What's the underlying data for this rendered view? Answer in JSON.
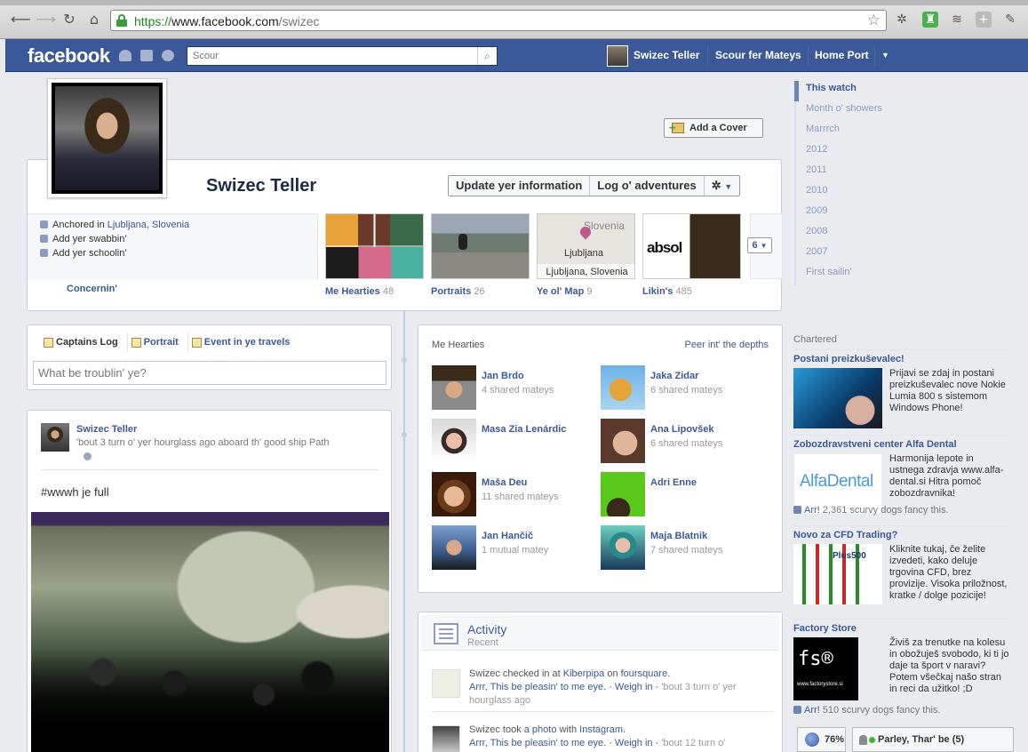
{
  "browser": {
    "url_scheme": "https://",
    "url_domain": "www.facebook.com",
    "url_path": "/swizec"
  },
  "fb_header": {
    "logo": "facebook",
    "search_placeholder": "Scour",
    "user_name": "Swizec Teller",
    "nav_find_friends": "Scour fer Mateys",
    "nav_home": "Home Port",
    "account_menu_icon": "chevron-down-icon"
  },
  "profile": {
    "name": "Swizec Teller",
    "add_cover_label": "Add a Cover",
    "update_info_label": "Update yer information",
    "activity_log_label": "Log o' adventures",
    "settings_icon": "gear-icon",
    "info": {
      "lives_prefix": "Anchored in",
      "lives_place": "Ljubljana, Slovenia",
      "add_work": "Add yer swabbin'",
      "add_school": "Add yer schoolin'",
      "about": "Concernin'"
    },
    "tiles": [
      {
        "label": "Me Hearties",
        "count": "48"
      },
      {
        "label": "Portraits",
        "count": "26"
      },
      {
        "label": "Ye ol' Map",
        "count": "9"
      },
      {
        "label": "Likin's",
        "count": "485"
      }
    ],
    "map_tile": {
      "country": "Slovenia",
      "city": "Ljubljana",
      "place": "Ljubljana, Slovenia"
    },
    "likes_tile_text": "absol",
    "more_tiles_count": "6"
  },
  "timeline_nav": [
    "This watch",
    "Month o' showers",
    "Marrrch",
    "2012",
    "2011",
    "2010",
    "2009",
    "2008",
    "2007",
    "First sailin'"
  ],
  "composer": {
    "tabs": [
      "Captains Log",
      "Portrait",
      "Event in ye travels"
    ],
    "placeholder": "What be troublin' ye?"
  },
  "post": {
    "author": "Swizec Teller",
    "meta": "'bout 3 turn o' yer hourglass ago aboard th' good ship Path",
    "text": "#wwwh je full"
  },
  "friends_box": {
    "title": "Me Hearties",
    "see_all": "Peer int' the depths",
    "friends": [
      {
        "name": "Jan Brdo",
        "mutual": "4 shared mateys"
      },
      {
        "name": "Jaka Zidar",
        "mutual": "6 shared mateys"
      },
      {
        "name": "Masa Zia Lenárdic",
        "mutual": ""
      },
      {
        "name": "Ana Lipovšek",
        "mutual": "6 shared mateys"
      },
      {
        "name": "Maša Deu",
        "mutual": "11 shared mateys"
      },
      {
        "name": "Adri Enne",
        "mutual": ""
      },
      {
        "name": "Jan Hančič",
        "mutual": "1 mutual matey"
      },
      {
        "name": "Maja Blatnik",
        "mutual": "7 shared mateys"
      }
    ]
  },
  "activity": {
    "title": "Activity",
    "subtitle": "Recent",
    "items": [
      {
        "pre": "Swizec checked in at ",
        "place": "Kiberpipa",
        "mid": " on ",
        "app": "foursquare",
        "end": ".",
        "like": "Arrr, This be pleasin' to me eye.",
        "comment": "Weigh in",
        "time": "'bout 3 turn o' yer hourglass ago"
      },
      {
        "pre": "Swizec took ",
        "place": "a photo",
        "mid": " with ",
        "app": "Instagram",
        "end": ".",
        "like": "Arrr, This be pleasin' to me eye.",
        "comment": "Weigh in",
        "time": "'bout 12 turn o'"
      }
    ]
  },
  "sponsored": {
    "title": "Chartered",
    "ads": [
      {
        "title": "Postani preizkuševalec!",
        "body": "Prijavi se zdaj in postani preizkuševalec nove Nokie Lumia 800 s sistemom Windows Phone!",
        "like": ""
      },
      {
        "title": "Zobozdravstveni center Alfa Dental",
        "body": "Harmonija lepote in ustnega zdravja www.alfa-dental.si Hitra pomoč zobozdravnika!",
        "image_text": "AlfaDental",
        "like_link": "Arr!",
        "like_text": "2,361 scurvy dogs fancy this."
      },
      {
        "title": "Novo za CFD Trading?",
        "body": "Kliknite tukaj, če želite izvedeti, kako deluje trgovina CFD, brez provizije. Visoka priložnost, kratke / dolge pozicije!",
        "image_text": "Plus500",
        "like": ""
      },
      {
        "title": "Factory Store",
        "body": "Živiš za trenutke na kolesu in obožuješ svobodo, ki ti jo daje ta šport v naravi? Potem všečkaj našo stran in reci da užitko! ;D",
        "image_text": "fs®",
        "image_subtext": "www.factorystore.si",
        "like_link": "Arr!",
        "like_text": "510 scurvy dogs fancy this."
      }
    ]
  },
  "chat": {
    "percent": "76%",
    "label": "Parley, Thar' be (5)"
  }
}
